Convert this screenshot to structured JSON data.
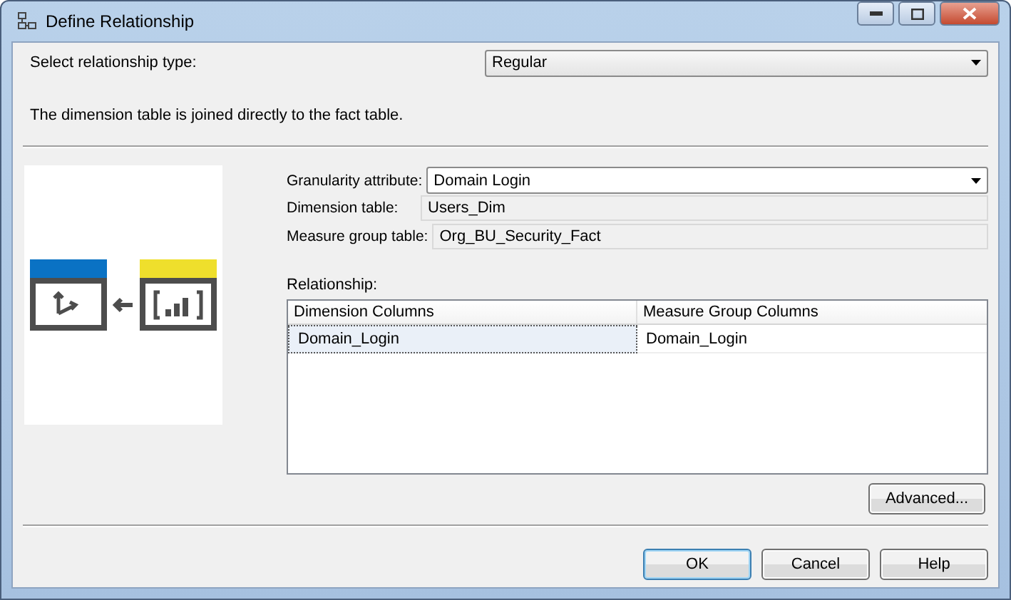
{
  "window": {
    "title": "Define Relationship"
  },
  "relationship_type": {
    "label": "Select relationship type:",
    "value": "Regular"
  },
  "description": "The dimension table is joined directly to the fact table.",
  "fields": [
    {
      "kind": "dropdown",
      "label": "Granularity attribute:",
      "value": "Domain Login"
    },
    {
      "kind": "readonly",
      "label": "Dimension table:",
      "value": "Users_Dim"
    },
    {
      "kind": "readonly",
      "label": "Measure group table:",
      "value": "Org_BU_Security_Fact"
    }
  ],
  "relationship": {
    "label": "Relationship:",
    "columns": [
      "Dimension Columns",
      "Measure Group Columns"
    ],
    "rows": [
      {
        "cells": [
          "Domain_Login",
          "Domain_Login"
        ],
        "selected": true
      }
    ]
  },
  "advanced_button": "Advanced...",
  "buttons": [
    {
      "label": "OK",
      "default": true
    },
    {
      "label": "Cancel",
      "default": false
    },
    {
      "label": "Help",
      "default": false
    }
  ]
}
